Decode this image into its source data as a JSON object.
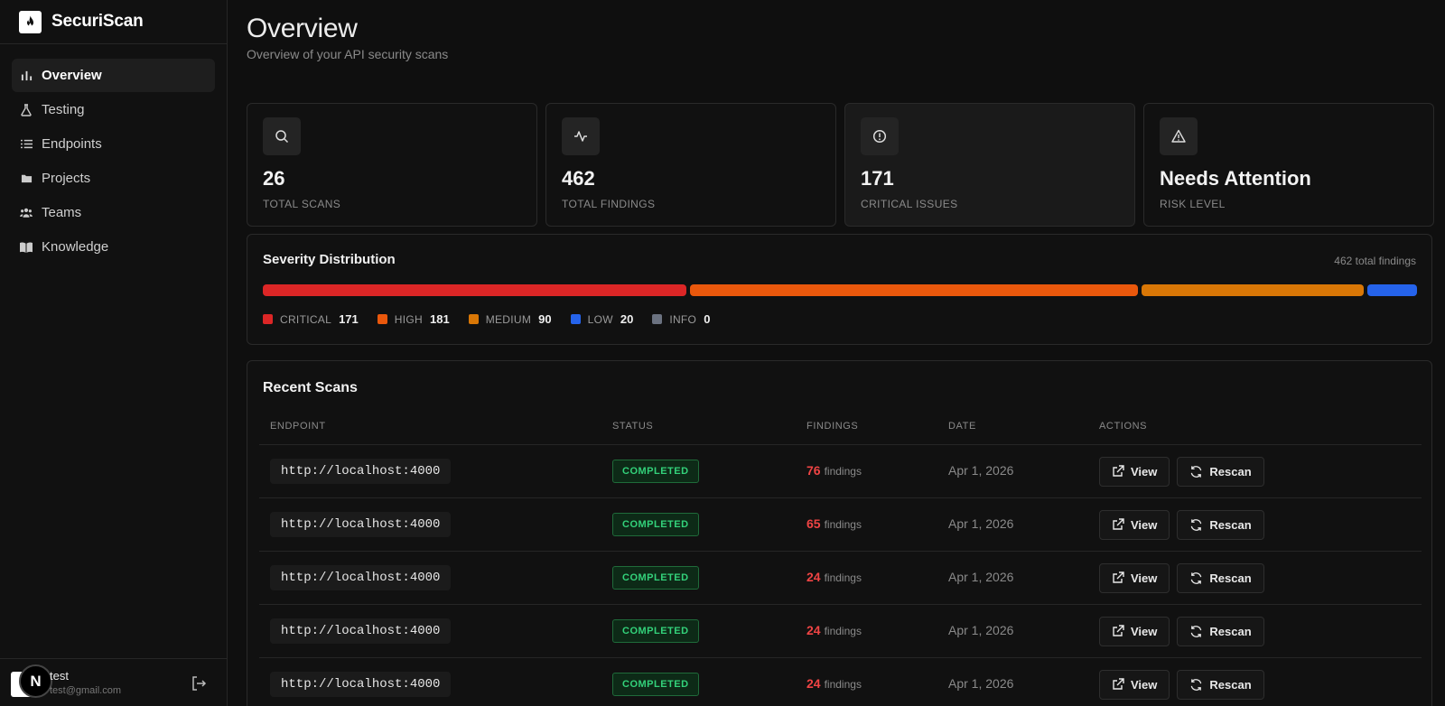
{
  "brand": {
    "name": "SecuriScan",
    "icon": "flame-icon"
  },
  "sidebar": {
    "items": [
      {
        "label": "Overview",
        "icon": "bar-chart-icon",
        "active": true
      },
      {
        "label": "Testing",
        "icon": "flask-icon",
        "active": false
      },
      {
        "label": "Endpoints",
        "icon": "list-icon",
        "active": false
      },
      {
        "label": "Projects",
        "icon": "folder-icon",
        "active": false
      },
      {
        "label": "Teams",
        "icon": "users-icon",
        "active": false
      },
      {
        "label": "Knowledge",
        "icon": "book-icon",
        "active": false
      }
    ],
    "user": {
      "name": "test",
      "email": "test@gmail.com",
      "badge": "N"
    }
  },
  "header": {
    "title": "Overview",
    "subtitle": "Overview of your API security scans"
  },
  "stats": [
    {
      "value": "26",
      "label": "TOTAL SCANS",
      "icon": "search-icon"
    },
    {
      "value": "462",
      "label": "TOTAL FINDINGS",
      "icon": "activity-icon"
    },
    {
      "value": "171",
      "label": "CRITICAL ISSUES",
      "icon": "alert-circle-icon"
    },
    {
      "value": "Needs Attention",
      "label": "RISK LEVEL",
      "icon": "alert-triangle-icon"
    }
  ],
  "severity": {
    "title": "Severity Distribution",
    "total_text": "462 total findings",
    "levels": [
      {
        "name": "CRITICAL",
        "count": 171,
        "color": "#dc2626"
      },
      {
        "name": "HIGH",
        "count": 181,
        "color": "#ea580c"
      },
      {
        "name": "MEDIUM",
        "count": 90,
        "color": "#d97706"
      },
      {
        "name": "LOW",
        "count": 20,
        "color": "#2563eb"
      },
      {
        "name": "INFO",
        "count": 0,
        "color": "#6b7280"
      }
    ]
  },
  "recent": {
    "title": "Recent Scans",
    "columns": [
      "ENDPOINT",
      "STATUS",
      "FINDINGS",
      "DATE",
      "ACTIONS"
    ],
    "findings_word": "findings",
    "view_label": "View",
    "rescan_label": "Rescan",
    "rows": [
      {
        "endpoint": "http://localhost:4000",
        "status": "COMPLETED",
        "findings": "76",
        "date": "Apr 1, 2026"
      },
      {
        "endpoint": "http://localhost:4000",
        "status": "COMPLETED",
        "findings": "65",
        "date": "Apr 1, 2026"
      },
      {
        "endpoint": "http://localhost:4000",
        "status": "COMPLETED",
        "findings": "24",
        "date": "Apr 1, 2026"
      },
      {
        "endpoint": "http://localhost:4000",
        "status": "COMPLETED",
        "findings": "24",
        "date": "Apr 1, 2026"
      },
      {
        "endpoint": "http://localhost:4000",
        "status": "COMPLETED",
        "findings": "24",
        "date": "Apr 1, 2026"
      }
    ]
  },
  "colors": {
    "accent_success": "#33d17a",
    "findings_red": "#ef4444",
    "background": "#0f0f0f"
  }
}
